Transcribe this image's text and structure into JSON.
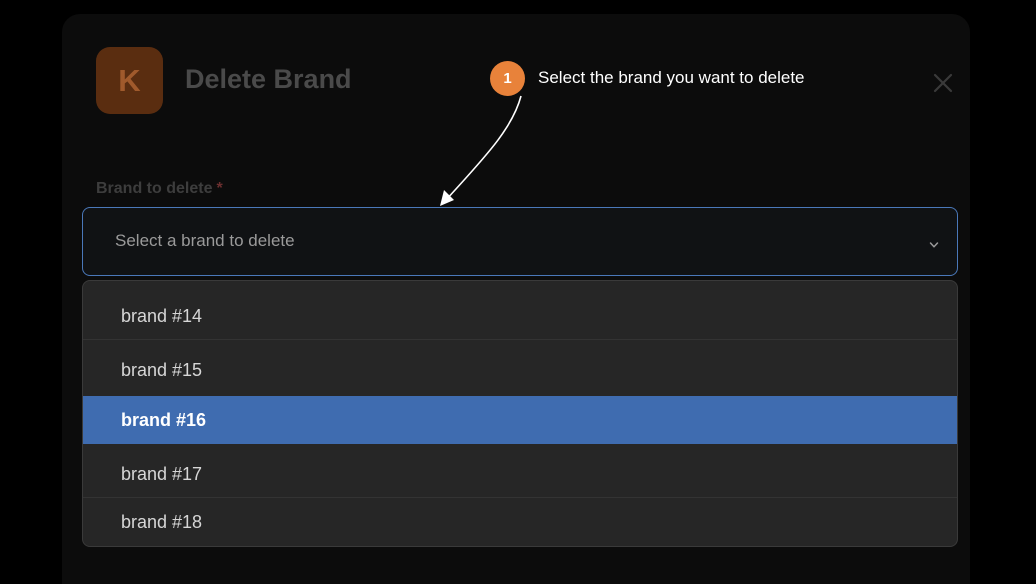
{
  "modal": {
    "logo_letter": "K",
    "title": "Delete Brand",
    "close_icon": "close-icon"
  },
  "callout": {
    "step_number": "1",
    "text": "Select the brand you want to delete"
  },
  "field": {
    "label": "Brand to delete",
    "required_marker": "*",
    "placeholder": "Select a brand to delete",
    "chevron_icon": "chevron-down-icon"
  },
  "dropdown": {
    "options": [
      {
        "label": "brand #14"
      },
      {
        "label": "brand #15"
      },
      {
        "label": "brand #16",
        "highlighted": true
      },
      {
        "label": "brand #17"
      },
      {
        "label": "brand #18"
      }
    ]
  },
  "colors": {
    "accent_blue": "#3f6cb0",
    "focus_border": "#4a78b9",
    "callout_orange": "#e8823a",
    "logo_bg": "#5a2d10"
  }
}
